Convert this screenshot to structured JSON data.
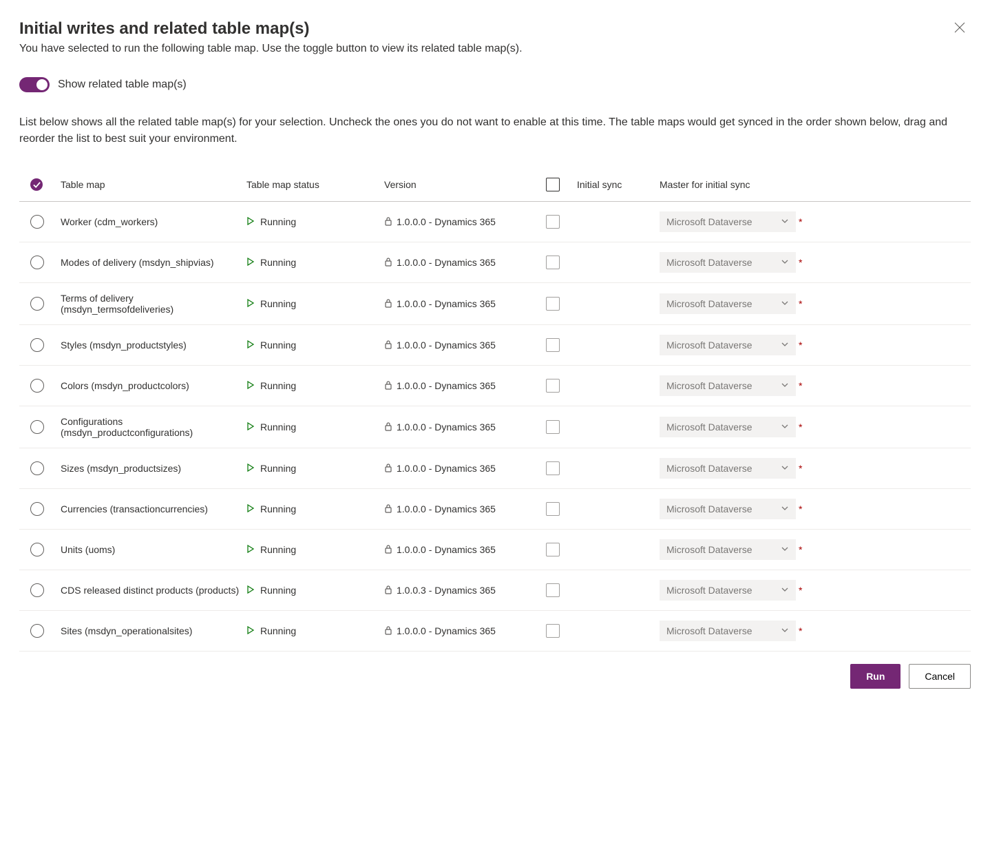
{
  "header": {
    "title": "Initial writes and related table map(s)",
    "subtitle": "You have selected to run the following table map. Use the toggle button to view its related table map(s)."
  },
  "toggle": {
    "label": "Show related table map(s)",
    "on": true
  },
  "description": "List below shows all the related table map(s) for your selection. Uncheck the ones you do not want to enable at this time. The table maps would get synced in the order shown below, drag and reorder the list to best suit your environment.",
  "columns": {
    "tableMap": "Table map",
    "status": "Table map status",
    "version": "Version",
    "initialSync": "Initial sync",
    "master": "Master for initial sync"
  },
  "masterDefault": "Microsoft Dataverse",
  "rows": [
    {
      "name": "Worker (cdm_workers)",
      "status": "Running",
      "version": "1.0.0.0 - Dynamics 365",
      "master": "Microsoft Dataverse"
    },
    {
      "name": "Modes of delivery (msdyn_shipvias)",
      "status": "Running",
      "version": "1.0.0.0 - Dynamics 365",
      "master": "Microsoft Dataverse"
    },
    {
      "name": "Terms of delivery (msdyn_termsofdeliveries)",
      "status": "Running",
      "version": "1.0.0.0 - Dynamics 365",
      "master": "Microsoft Dataverse"
    },
    {
      "name": "Styles (msdyn_productstyles)",
      "status": "Running",
      "version": "1.0.0.0 - Dynamics 365",
      "master": "Microsoft Dataverse"
    },
    {
      "name": "Colors (msdyn_productcolors)",
      "status": "Running",
      "version": "1.0.0.0 - Dynamics 365",
      "master": "Microsoft Dataverse"
    },
    {
      "name": "Configurations (msdyn_productconfigurations)",
      "status": "Running",
      "version": "1.0.0.0 - Dynamics 365",
      "master": "Microsoft Dataverse"
    },
    {
      "name": "Sizes (msdyn_productsizes)",
      "status": "Running",
      "version": "1.0.0.0 - Dynamics 365",
      "master": "Microsoft Dataverse"
    },
    {
      "name": "Currencies (transactioncurrencies)",
      "status": "Running",
      "version": "1.0.0.0 - Dynamics 365",
      "master": "Microsoft Dataverse"
    },
    {
      "name": "Units (uoms)",
      "status": "Running",
      "version": "1.0.0.0 - Dynamics 365",
      "master": "Microsoft Dataverse"
    },
    {
      "name": "CDS released distinct products (products)",
      "status": "Running",
      "version": "1.0.0.3 - Dynamics 365",
      "master": "Microsoft Dataverse"
    },
    {
      "name": "Sites (msdyn_operationalsites)",
      "status": "Running",
      "version": "1.0.0.0 - Dynamics 365",
      "master": "Microsoft Dataverse"
    }
  ],
  "footer": {
    "run": "Run",
    "cancel": "Cancel"
  }
}
